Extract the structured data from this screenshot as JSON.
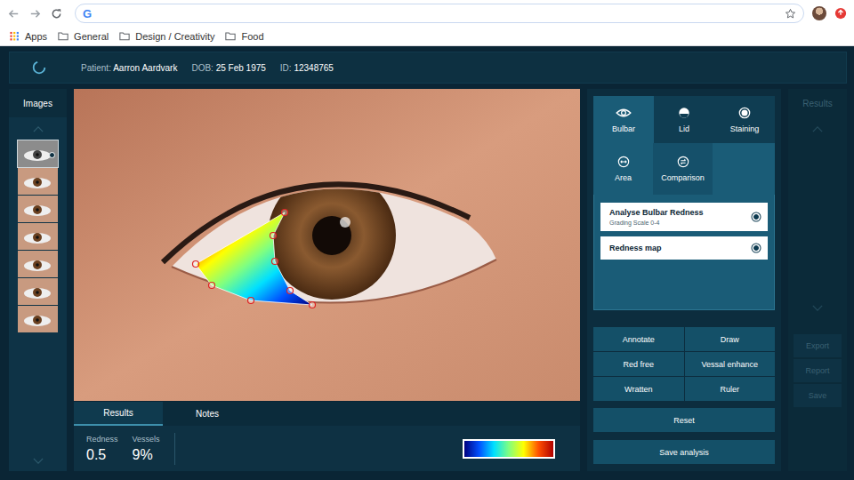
{
  "browser": {
    "engine_logo": "G",
    "bookmarks": [
      {
        "label": "Apps",
        "kind": "apps"
      },
      {
        "label": "General",
        "kind": "folder"
      },
      {
        "label": "Design / Creativity",
        "kind": "folder"
      },
      {
        "label": "Food",
        "kind": "folder"
      }
    ]
  },
  "header": {
    "fields": [
      {
        "label": "Patient:",
        "value": "Aarron Aardvark"
      },
      {
        "label": "DOB:",
        "value": "25 Feb 1975"
      },
      {
        "label": "ID:",
        "value": "12348765"
      }
    ]
  },
  "images": {
    "title": "Images",
    "thumbnails": [
      {
        "selected": true
      },
      {
        "selected": false
      },
      {
        "selected": false
      },
      {
        "selected": false
      },
      {
        "selected": false
      },
      {
        "selected": false
      },
      {
        "selected": false
      }
    ]
  },
  "results": {
    "tabs": [
      {
        "label": "Results",
        "selected": true
      },
      {
        "label": "Notes",
        "selected": false
      }
    ],
    "metrics": [
      {
        "label": "Redness",
        "value": "0.5"
      },
      {
        "label": "Vessels",
        "value": "9%"
      }
    ],
    "legend": [
      {
        "color": "#00007f"
      },
      {
        "color": "#0050ff"
      },
      {
        "color": "#00e0ff"
      },
      {
        "color": "#80ff80"
      },
      {
        "color": "#ffff00"
      },
      {
        "color": "#ff5000"
      },
      {
        "color": "#b00000"
      }
    ]
  },
  "analysis_tabs": [
    {
      "label": "Bulbar",
      "selected": true
    },
    {
      "label": "Lid",
      "selected": false
    },
    {
      "label": "Staining",
      "selected": false
    }
  ],
  "mode_tabs": [
    {
      "label": "Area",
      "selected": true
    },
    {
      "label": "Comparison",
      "selected": false
    }
  ],
  "analyses": [
    {
      "title": "Analyse Bulbar Redness",
      "subtitle": "Grading Scale 0-4",
      "selected": true
    },
    {
      "title": "Redness map",
      "subtitle": "",
      "selected": true
    }
  ],
  "tools": [
    "Annotate",
    "Draw",
    "Red free",
    "Vessal enhance",
    "Wratten",
    "Ruler"
  ],
  "actions": [
    "Reset",
    "Save analysis"
  ],
  "results_panel": {
    "title": "Results",
    "disabled": true,
    "buttons": [
      {
        "label": "Export",
        "disabled": true
      },
      {
        "label": "Report",
        "disabled": true
      },
      {
        "label": "Save",
        "disabled": true
      }
    ]
  }
}
